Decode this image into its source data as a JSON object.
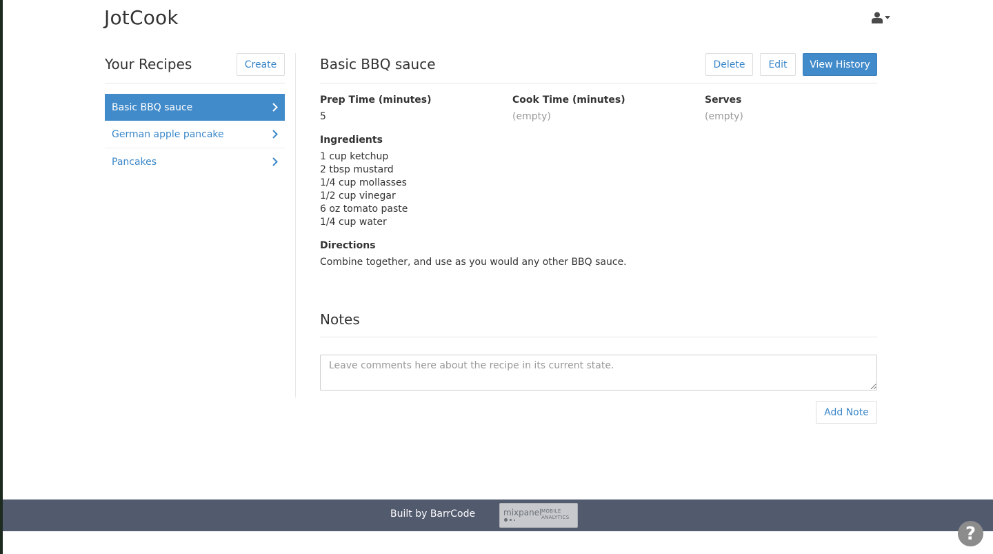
{
  "app": {
    "title": "JotCook"
  },
  "sidebar": {
    "title": "Your Recipes",
    "create_label": "Create",
    "items": [
      {
        "label": "Basic BBQ sauce",
        "active": true
      },
      {
        "label": "German apple pancake",
        "active": false
      },
      {
        "label": "Pancakes",
        "active": false
      }
    ]
  },
  "recipe": {
    "title": "Basic BBQ sauce",
    "actions": {
      "delete": "Delete",
      "edit": "Edit",
      "history": "View History"
    },
    "prep_label": "Prep Time (minutes)",
    "prep_value": "5",
    "cook_label": "Cook Time (minutes)",
    "cook_value": "(empty)",
    "serves_label": "Serves",
    "serves_value": "(empty)",
    "ingredients_label": "Ingredients",
    "ingredients": [
      "1 cup ketchup",
      "2 tbsp mustard",
      "1/4 cup mollasses",
      "1/2 cup vinegar",
      "6 oz tomato paste",
      "1/4 cup water"
    ],
    "directions_label": "Directions",
    "directions": "Combine together, and use as you would any other BBQ sauce."
  },
  "notes": {
    "title": "Notes",
    "placeholder": "Leave comments here about the recipe in its current state.",
    "add_label": "Add Note"
  },
  "footer": {
    "text": "Built by BarrCode",
    "badge_word": "mixpanel",
    "badge_line1": "MOBILE",
    "badge_line2": "ANALYTICS"
  },
  "help": {
    "label": "?"
  },
  "colors": {
    "accent": "#428bca",
    "link": "#3a87c9",
    "footer": "#525a6e",
    "muted": "#999999"
  },
  "icons": [
    "user-icon",
    "caret-down-icon",
    "chevron-right-icon",
    "help-icon"
  ]
}
